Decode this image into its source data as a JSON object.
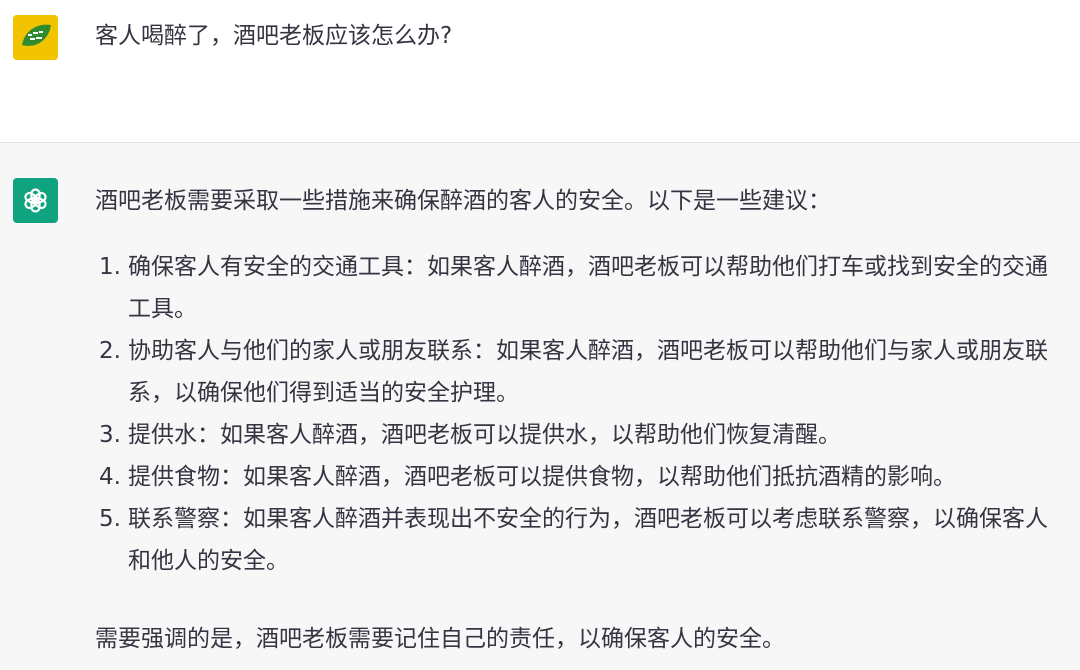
{
  "user_message": {
    "text": "客人喝醉了，酒吧老板应该怎么办?"
  },
  "assistant_message": {
    "intro": "酒吧老板需要采取一些措施来确保醉酒的客人的安全。以下是一些建议：",
    "items": [
      {
        "num": "1.",
        "text": "确保客人有安全的交通工具：如果客人醉酒，酒吧老板可以帮助他们打车或找到安全的交通工具。"
      },
      {
        "num": "2.",
        "text": "协助客人与他们的家人或朋友联系：如果客人醉酒，酒吧老板可以帮助他们与家人或朋友联系，以确保他们得到适当的安全护理。"
      },
      {
        "num": "3.",
        "text": "提供水：如果客人醉酒，酒吧老板可以提供水，以帮助他们恢复清醒。"
      },
      {
        "num": "4.",
        "text": "提供食物：如果客人醉酒，酒吧老板可以提供食物，以帮助他们抵抗酒精的影响。"
      },
      {
        "num": "5.",
        "text": "联系警察：如果客人醉酒并表现出不安全的行为，酒吧老板可以考虑联系警察，以确保客人和他人的安全。"
      }
    ],
    "closing": "需要强调的是，酒吧老板需要记住自己的责任，以确保客人的安全。"
  },
  "colors": {
    "assistant_bg": "#f7f7f8",
    "user_bg": "#ffffff",
    "gpt_avatar": "#10a37f",
    "user_avatar": "#f2c400",
    "text": "#343541"
  },
  "icons": {
    "user_avatar": "user-avatar-icon",
    "assistant_avatar": "openai-logo-icon"
  }
}
